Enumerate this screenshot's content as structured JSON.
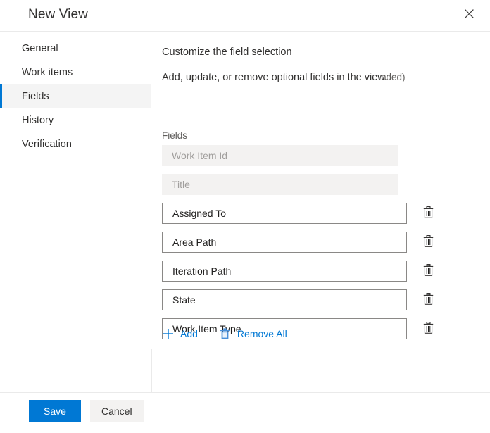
{
  "dialog": {
    "title": "New View",
    "close_icon": "close-icon"
  },
  "sidebar": {
    "items": [
      {
        "label": "General",
        "selected": false
      },
      {
        "label": "Work items",
        "selected": false
      },
      {
        "label": "Fields",
        "selected": true
      },
      {
        "label": "History",
        "selected": false
      },
      {
        "label": "Verification",
        "selected": false
      }
    ]
  },
  "main": {
    "heading": "Customize the field selection",
    "description": "Add, update, or remove optional fields in the view.",
    "description_fragment": "nded)",
    "fields_label": "Fields",
    "fields": [
      {
        "value": "Work Item Id",
        "editable": false,
        "deletable": false
      },
      {
        "value": "Title",
        "editable": false,
        "deletable": false
      },
      {
        "value": "Assigned To",
        "editable": true,
        "deletable": true
      },
      {
        "value": "Area Path",
        "editable": true,
        "deletable": true
      },
      {
        "value": "Iteration Path",
        "editable": true,
        "deletable": true
      },
      {
        "value": "State",
        "editable": true,
        "deletable": true
      },
      {
        "value": "Work Item Type",
        "editable": true,
        "deletable": true
      }
    ],
    "commands": {
      "add_label": "Add",
      "add_icon": "plus-icon",
      "remove_all_label": "Remove All",
      "remove_all_icon": "trash-icon"
    },
    "row_delete_icon": "trash-icon"
  },
  "footer": {
    "save_label": "Save",
    "cancel_label": "Cancel"
  },
  "colors": {
    "accent": "#0078d4",
    "selected_nav_background": "#f4f4f4",
    "disabled_field_background": "#f3f2f1",
    "disabled_field_text": "#a19f9d",
    "field_border": "#8a8886",
    "divider": "#eaeaea",
    "secondary_button_background": "#f3f2f1",
    "body_text": "#323130"
  }
}
